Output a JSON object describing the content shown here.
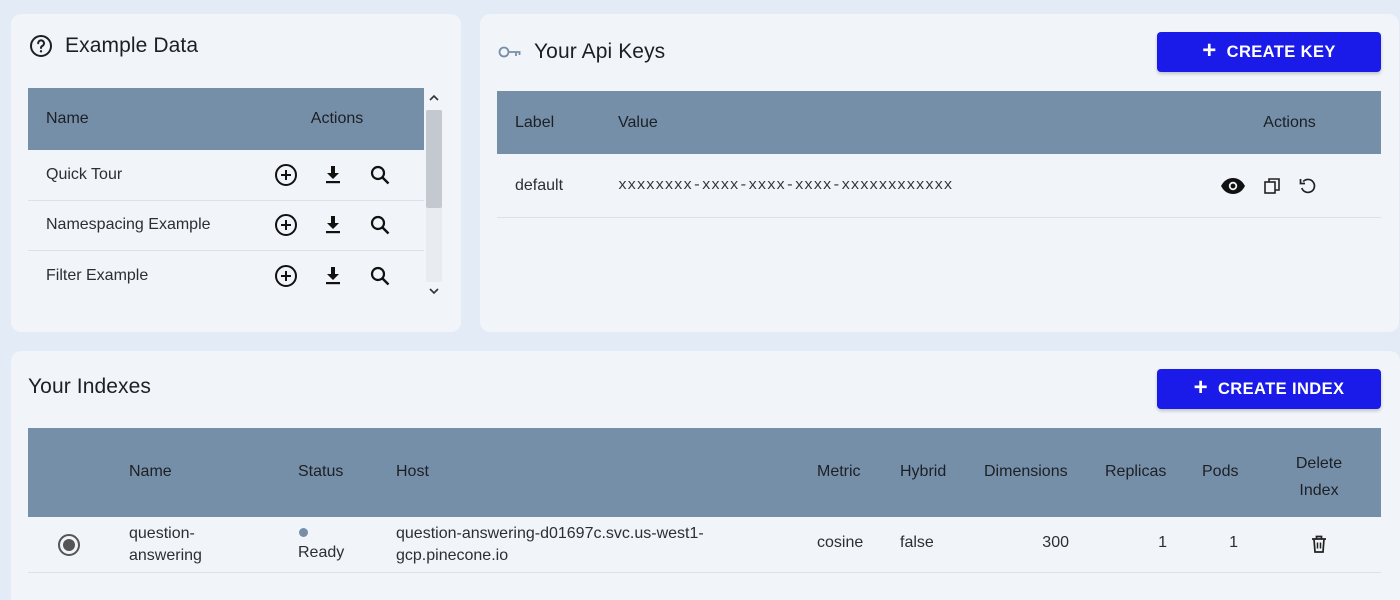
{
  "example_data": {
    "title": "Example Data",
    "columns": {
      "name": "Name",
      "actions": "Actions"
    },
    "rows": [
      {
        "name": "Quick Tour"
      },
      {
        "name": "Namespacing Example"
      },
      {
        "name": "Filter Example"
      }
    ],
    "row_action_icons": [
      "add-circle-icon",
      "download-icon",
      "search-icon"
    ]
  },
  "api_keys": {
    "title": "Your Api Keys",
    "create_button": "CREATE KEY",
    "columns": {
      "label": "Label",
      "value": "Value",
      "actions": "Actions"
    },
    "rows": [
      {
        "label": "default",
        "value": "xxxxxxxx-xxxx-xxxx-xxxx-xxxxxxxxxxxx"
      }
    ],
    "row_action_icons": [
      "eye-icon",
      "copy-icon",
      "refresh-icon"
    ]
  },
  "indexes": {
    "title": "Your Indexes",
    "create_button": "CREATE INDEX",
    "columns": {
      "name": "Name",
      "status": "Status",
      "host": "Host",
      "metric": "Metric",
      "hybrid": "Hybrid",
      "dimensions": "Dimensions",
      "replicas": "Replicas",
      "pods": "Pods",
      "delete_line1": "Delete",
      "delete_line2": "Index"
    },
    "rows": [
      {
        "selected": true,
        "name_line1": "question-",
        "name_line2": "answering",
        "status": "Ready",
        "host_line1": "question-answering-d01697c.svc.us-west1-",
        "host_line2": "gcp.pinecone.io",
        "metric": "cosine",
        "hybrid": "false",
        "dimensions": "300",
        "replicas": "1",
        "pods": "1"
      }
    ]
  },
  "colors": {
    "page_bg": "#e3ebf6",
    "card_bg": "#f1f4f9",
    "table_header": "#768fa9",
    "primary_button": "#1a1be8"
  }
}
